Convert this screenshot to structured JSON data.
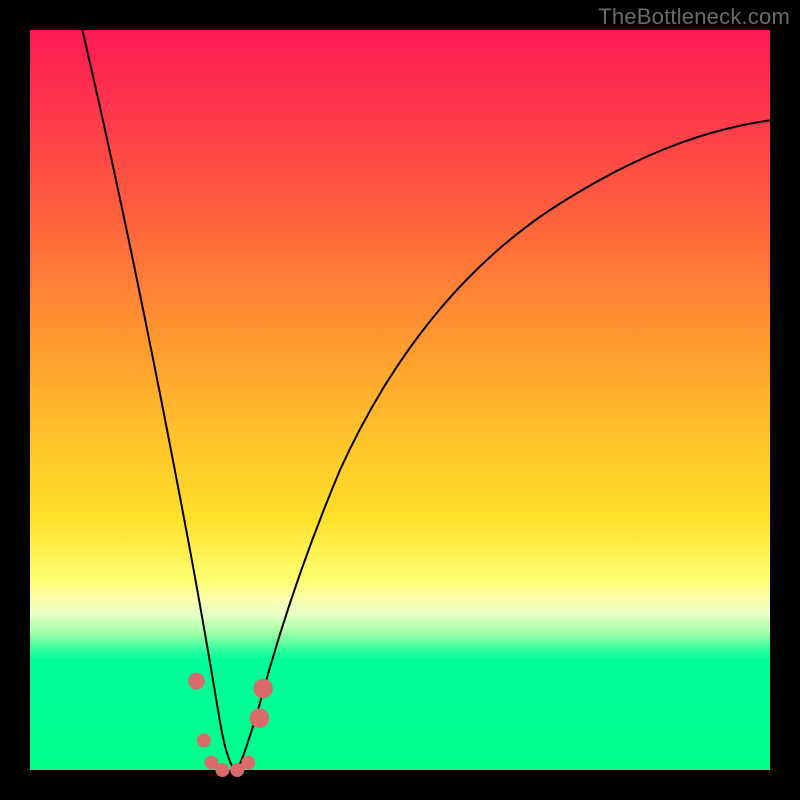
{
  "watermark": "TheBottleneck.com",
  "colors": {
    "frame_bg": "#000000",
    "gradient_top": "#ff1a55",
    "gradient_bottom": "#00ff8a",
    "curve_stroke": "#000000",
    "marker_fill": "#d96b6b",
    "watermark_color": "#6a6a6a"
  },
  "chart_data": {
    "type": "line",
    "title": "",
    "xlabel": "",
    "ylabel": "",
    "xlim": [
      0,
      100
    ],
    "ylim": [
      0,
      100
    ],
    "grid": false,
    "description": "V-shaped bottleneck curve with minimum near x≈27, overlaid on vertical rainbow gradient (red→yellow→green). Curve value ≈ |1 - x/27| * 100 (clamped).",
    "curve_min_x": 27,
    "curve_min_y": 0,
    "left_branch_top": {
      "x": 5,
      "y": 100
    },
    "right_branch_top": {
      "x": 100,
      "y": 80
    },
    "series": [
      {
        "name": "bottleneck-curve",
        "x": [
          5,
          10,
          15,
          18,
          20,
          22,
          24,
          26,
          27,
          28,
          30,
          34,
          40,
          50,
          60,
          70,
          80,
          90,
          100
        ],
        "y": [
          100,
          72,
          45,
          30,
          22,
          15,
          9,
          3,
          0,
          2,
          7,
          16,
          29,
          44,
          54,
          62,
          69,
          75,
          80
        ]
      }
    ],
    "markers": [
      {
        "x": 22.5,
        "y": 12,
        "r": 1.2
      },
      {
        "x": 23.5,
        "y": 4,
        "r": 1.0
      },
      {
        "x": 24.5,
        "y": 1,
        "r": 1.0
      },
      {
        "x": 26.0,
        "y": 0,
        "r": 1.0
      },
      {
        "x": 28.0,
        "y": 0,
        "r": 1.0
      },
      {
        "x": 29.5,
        "y": 1,
        "r": 1.0
      },
      {
        "x": 31.0,
        "y": 7,
        "r": 1.4
      },
      {
        "x": 31.5,
        "y": 11,
        "r": 1.4
      }
    ]
  }
}
